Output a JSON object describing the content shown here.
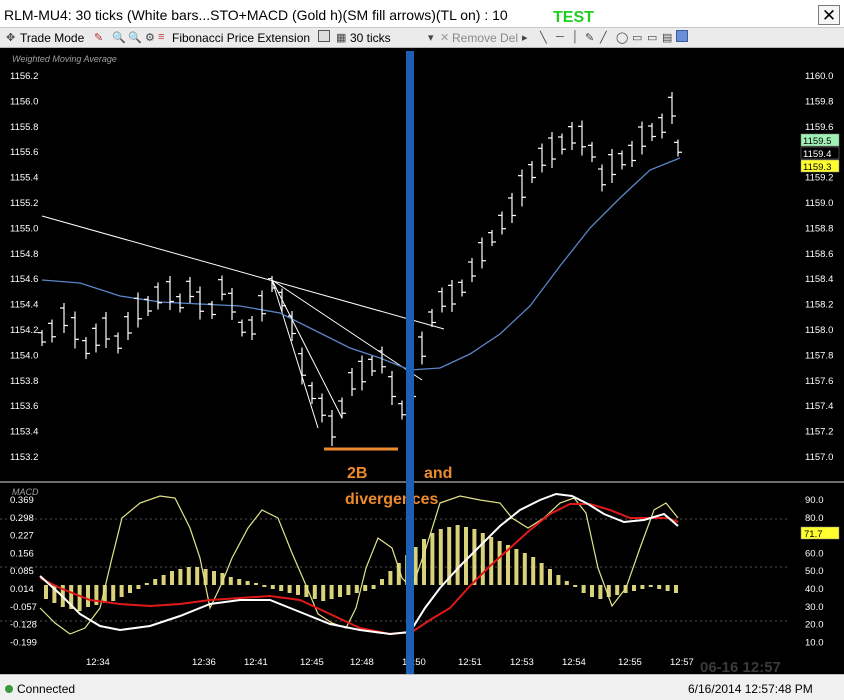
{
  "window": {
    "title": "RLM-MU4: 30 ticks (White bars...STO+MACD (Gold h)(SM fill arrows)(TL on) : 10",
    "test_label": "TEST",
    "test_color": "#1ecf1e",
    "close_icon": "close-icon"
  },
  "toolbar": {
    "mode_label": "Trade Mode",
    "fib_label": "Fibonacci Price Extension",
    "interval_label": "30 ticks",
    "remove_label": "Remove Del"
  },
  "price_panel": {
    "title": "Weighted Moving Average",
    "left_axis": [
      "1156.2",
      "1156.0",
      "1155.8",
      "1155.6",
      "1155.4",
      "1155.2",
      "1155.0",
      "1154.8",
      "1154.6",
      "1154.4",
      "1154.2",
      "1154.0",
      "1153.8",
      "1153.6",
      "1153.4",
      "1153.2"
    ],
    "right_axis": [
      "1160.0",
      "1159.8",
      "1159.6",
      "1159.4",
      "1159.2",
      "1159.0",
      "1158.8",
      "1158.6",
      "1158.4",
      "1158.2",
      "1158.0",
      "1157.8",
      "1157.6",
      "1157.4",
      "1157.2",
      "1157.0"
    ],
    "price_tags": [
      {
        "value": "1159.5",
        "color": "#9ef0b4"
      },
      {
        "value": "1159.4",
        "color": "#ffffff"
      },
      {
        "value": "1159.3",
        "color": "#ffff30"
      }
    ]
  },
  "macd_panel": {
    "title": "MACD",
    "left_axis": [
      "0.369",
      "0.298",
      "0.227",
      "0.156",
      "0.085",
      "0.014",
      "-0.057",
      "-0.128",
      "-0.199"
    ],
    "right_axis": [
      "90.0",
      "80.0",
      "70.0",
      "60.0",
      "50.0",
      "40.0",
      "30.0",
      "20.0",
      "10.0"
    ],
    "tag": {
      "value": "71.7",
      "color": "#ffff30"
    }
  },
  "time_axis": [
    "12:34",
    "12:36",
    "12:41",
    "12:45",
    "12:48",
    "12:50",
    "12:51",
    "12:53",
    "12:54",
    "12:55",
    "12:57"
  ],
  "watermark": "06-16 12:57",
  "annotations": {
    "label_2b": "2B",
    "label_and": "and",
    "label_div": "divergences"
  },
  "colors": {
    "bars": "#ffffff",
    "wma": "#5b86c8",
    "vertical_marker": "#1d5fb5",
    "annotation": "#ee8a2e",
    "stoch_line": "#e4e48a",
    "macd_white": "#ffffff",
    "macd_red": "#e01818",
    "histogram": "#d9d27a"
  },
  "status": {
    "connection": "Connected",
    "datetime": "6/16/2014 12:57:48 PM"
  }
}
